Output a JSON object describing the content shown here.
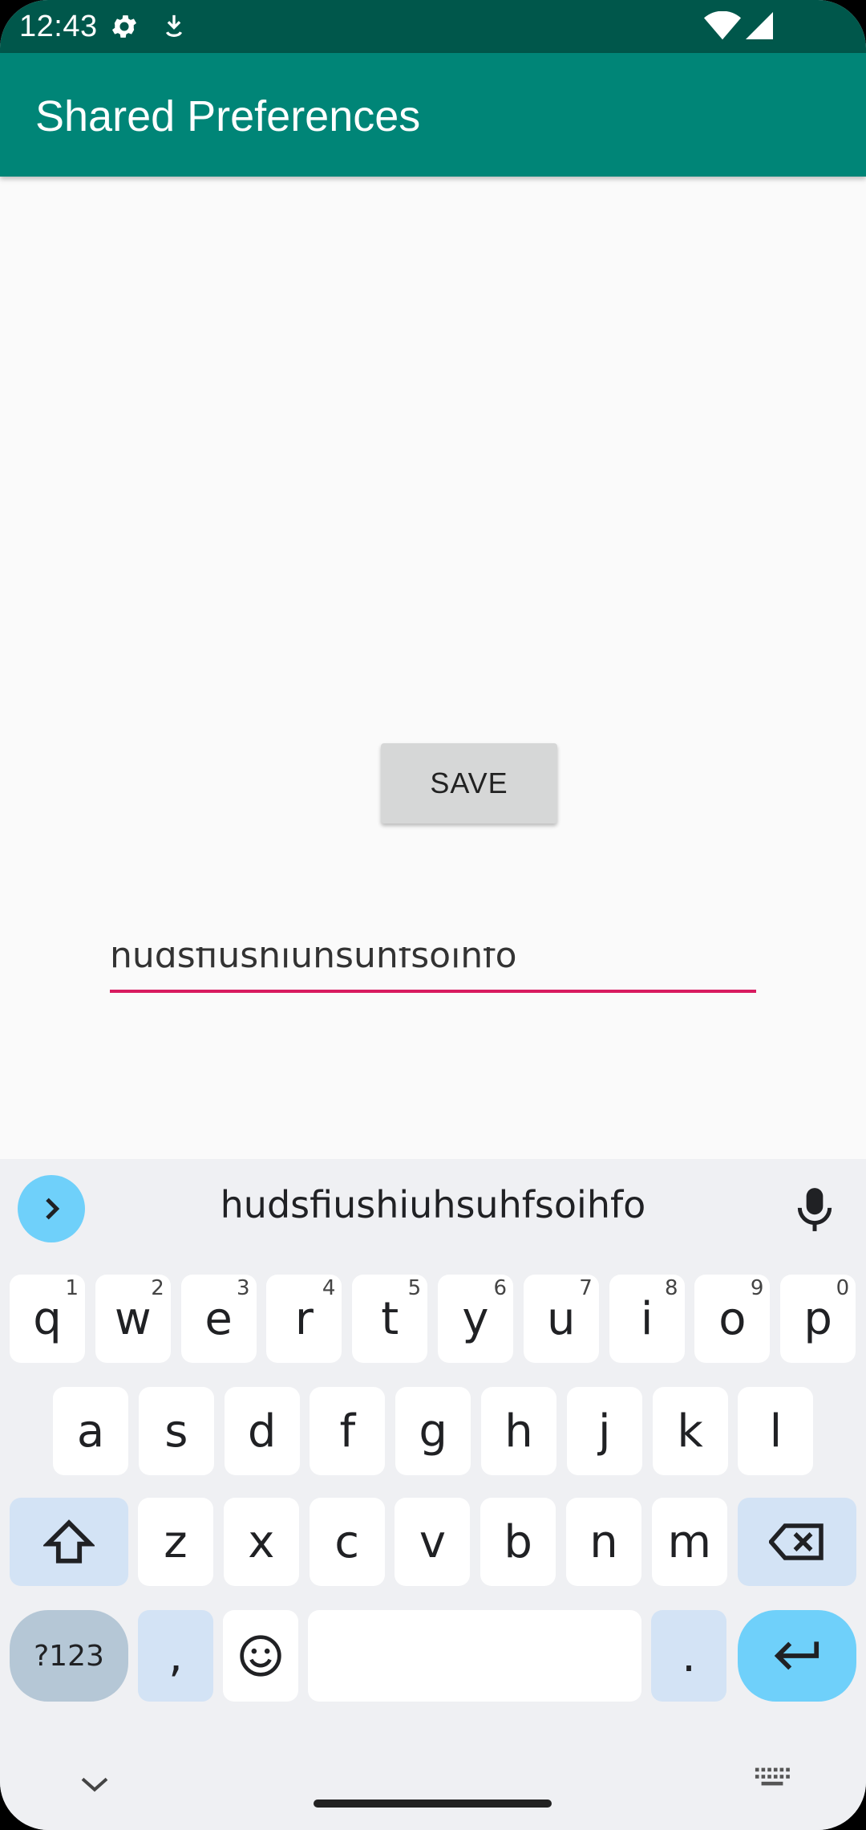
{
  "status_bar": {
    "time": "12:43",
    "icons": [
      "gear-icon",
      "download-icon",
      "wifi-icon",
      "signal-icon"
    ]
  },
  "app_bar": {
    "title": "Shared Preferences"
  },
  "main": {
    "save_button_label": "SAVE",
    "text_field_value": "hudsfiushiuhsuhfsoihfo"
  },
  "keyboard": {
    "suggestion": "hudsfiushiuhsuhfsoihfo",
    "row1": [
      {
        "label": "q",
        "hint": "1"
      },
      {
        "label": "w",
        "hint": "2"
      },
      {
        "label": "e",
        "hint": "3"
      },
      {
        "label": "r",
        "hint": "4"
      },
      {
        "label": "t",
        "hint": "5"
      },
      {
        "label": "y",
        "hint": "6"
      },
      {
        "label": "u",
        "hint": "7"
      },
      {
        "label": "i",
        "hint": "8"
      },
      {
        "label": "o",
        "hint": "9"
      },
      {
        "label": "p",
        "hint": "0"
      }
    ],
    "row2": [
      "a",
      "s",
      "d",
      "f",
      "g",
      "h",
      "j",
      "k",
      "l"
    ],
    "row3": [
      "z",
      "x",
      "c",
      "v",
      "b",
      "n",
      "m"
    ],
    "symbols_label": "?123",
    "comma_label": ",",
    "period_label": "."
  },
  "colors": {
    "status_bar": "#00574b",
    "app_bar": "#008577",
    "accent_underline": "#d81b60",
    "keyboard_accent": "#6fd0fa"
  }
}
